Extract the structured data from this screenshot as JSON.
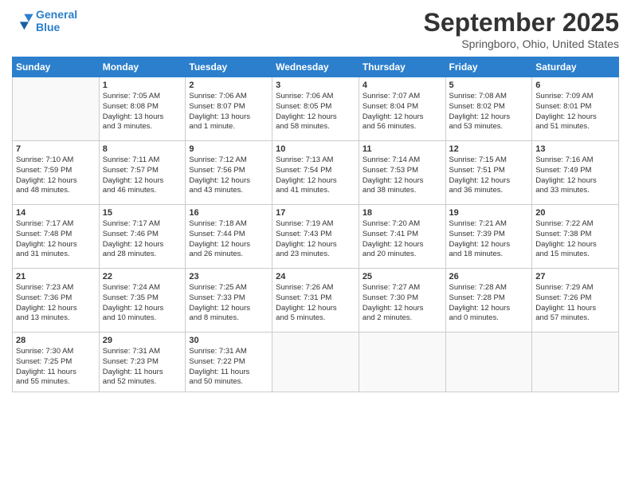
{
  "header": {
    "logo_line1": "General",
    "logo_line2": "Blue",
    "month": "September 2025",
    "location": "Springboro, Ohio, United States"
  },
  "weekdays": [
    "Sunday",
    "Monday",
    "Tuesday",
    "Wednesday",
    "Thursday",
    "Friday",
    "Saturday"
  ],
  "weeks": [
    [
      {
        "num": "",
        "info": ""
      },
      {
        "num": "1",
        "info": "Sunrise: 7:05 AM\nSunset: 8:08 PM\nDaylight: 13 hours\nand 3 minutes."
      },
      {
        "num": "2",
        "info": "Sunrise: 7:06 AM\nSunset: 8:07 PM\nDaylight: 13 hours\nand 1 minute."
      },
      {
        "num": "3",
        "info": "Sunrise: 7:06 AM\nSunset: 8:05 PM\nDaylight: 12 hours\nand 58 minutes."
      },
      {
        "num": "4",
        "info": "Sunrise: 7:07 AM\nSunset: 8:04 PM\nDaylight: 12 hours\nand 56 minutes."
      },
      {
        "num": "5",
        "info": "Sunrise: 7:08 AM\nSunset: 8:02 PM\nDaylight: 12 hours\nand 53 minutes."
      },
      {
        "num": "6",
        "info": "Sunrise: 7:09 AM\nSunset: 8:01 PM\nDaylight: 12 hours\nand 51 minutes."
      }
    ],
    [
      {
        "num": "7",
        "info": "Sunrise: 7:10 AM\nSunset: 7:59 PM\nDaylight: 12 hours\nand 48 minutes."
      },
      {
        "num": "8",
        "info": "Sunrise: 7:11 AM\nSunset: 7:57 PM\nDaylight: 12 hours\nand 46 minutes."
      },
      {
        "num": "9",
        "info": "Sunrise: 7:12 AM\nSunset: 7:56 PM\nDaylight: 12 hours\nand 43 minutes."
      },
      {
        "num": "10",
        "info": "Sunrise: 7:13 AM\nSunset: 7:54 PM\nDaylight: 12 hours\nand 41 minutes."
      },
      {
        "num": "11",
        "info": "Sunrise: 7:14 AM\nSunset: 7:53 PM\nDaylight: 12 hours\nand 38 minutes."
      },
      {
        "num": "12",
        "info": "Sunrise: 7:15 AM\nSunset: 7:51 PM\nDaylight: 12 hours\nand 36 minutes."
      },
      {
        "num": "13",
        "info": "Sunrise: 7:16 AM\nSunset: 7:49 PM\nDaylight: 12 hours\nand 33 minutes."
      }
    ],
    [
      {
        "num": "14",
        "info": "Sunrise: 7:17 AM\nSunset: 7:48 PM\nDaylight: 12 hours\nand 31 minutes."
      },
      {
        "num": "15",
        "info": "Sunrise: 7:17 AM\nSunset: 7:46 PM\nDaylight: 12 hours\nand 28 minutes."
      },
      {
        "num": "16",
        "info": "Sunrise: 7:18 AM\nSunset: 7:44 PM\nDaylight: 12 hours\nand 26 minutes."
      },
      {
        "num": "17",
        "info": "Sunrise: 7:19 AM\nSunset: 7:43 PM\nDaylight: 12 hours\nand 23 minutes."
      },
      {
        "num": "18",
        "info": "Sunrise: 7:20 AM\nSunset: 7:41 PM\nDaylight: 12 hours\nand 20 minutes."
      },
      {
        "num": "19",
        "info": "Sunrise: 7:21 AM\nSunset: 7:39 PM\nDaylight: 12 hours\nand 18 minutes."
      },
      {
        "num": "20",
        "info": "Sunrise: 7:22 AM\nSunset: 7:38 PM\nDaylight: 12 hours\nand 15 minutes."
      }
    ],
    [
      {
        "num": "21",
        "info": "Sunrise: 7:23 AM\nSunset: 7:36 PM\nDaylight: 12 hours\nand 13 minutes."
      },
      {
        "num": "22",
        "info": "Sunrise: 7:24 AM\nSunset: 7:35 PM\nDaylight: 12 hours\nand 10 minutes."
      },
      {
        "num": "23",
        "info": "Sunrise: 7:25 AM\nSunset: 7:33 PM\nDaylight: 12 hours\nand 8 minutes."
      },
      {
        "num": "24",
        "info": "Sunrise: 7:26 AM\nSunset: 7:31 PM\nDaylight: 12 hours\nand 5 minutes."
      },
      {
        "num": "25",
        "info": "Sunrise: 7:27 AM\nSunset: 7:30 PM\nDaylight: 12 hours\nand 2 minutes."
      },
      {
        "num": "26",
        "info": "Sunrise: 7:28 AM\nSunset: 7:28 PM\nDaylight: 12 hours\nand 0 minutes."
      },
      {
        "num": "27",
        "info": "Sunrise: 7:29 AM\nSunset: 7:26 PM\nDaylight: 11 hours\nand 57 minutes."
      }
    ],
    [
      {
        "num": "28",
        "info": "Sunrise: 7:30 AM\nSunset: 7:25 PM\nDaylight: 11 hours\nand 55 minutes."
      },
      {
        "num": "29",
        "info": "Sunrise: 7:31 AM\nSunset: 7:23 PM\nDaylight: 11 hours\nand 52 minutes."
      },
      {
        "num": "30",
        "info": "Sunrise: 7:31 AM\nSunset: 7:22 PM\nDaylight: 11 hours\nand 50 minutes."
      },
      {
        "num": "",
        "info": ""
      },
      {
        "num": "",
        "info": ""
      },
      {
        "num": "",
        "info": ""
      },
      {
        "num": "",
        "info": ""
      }
    ]
  ]
}
